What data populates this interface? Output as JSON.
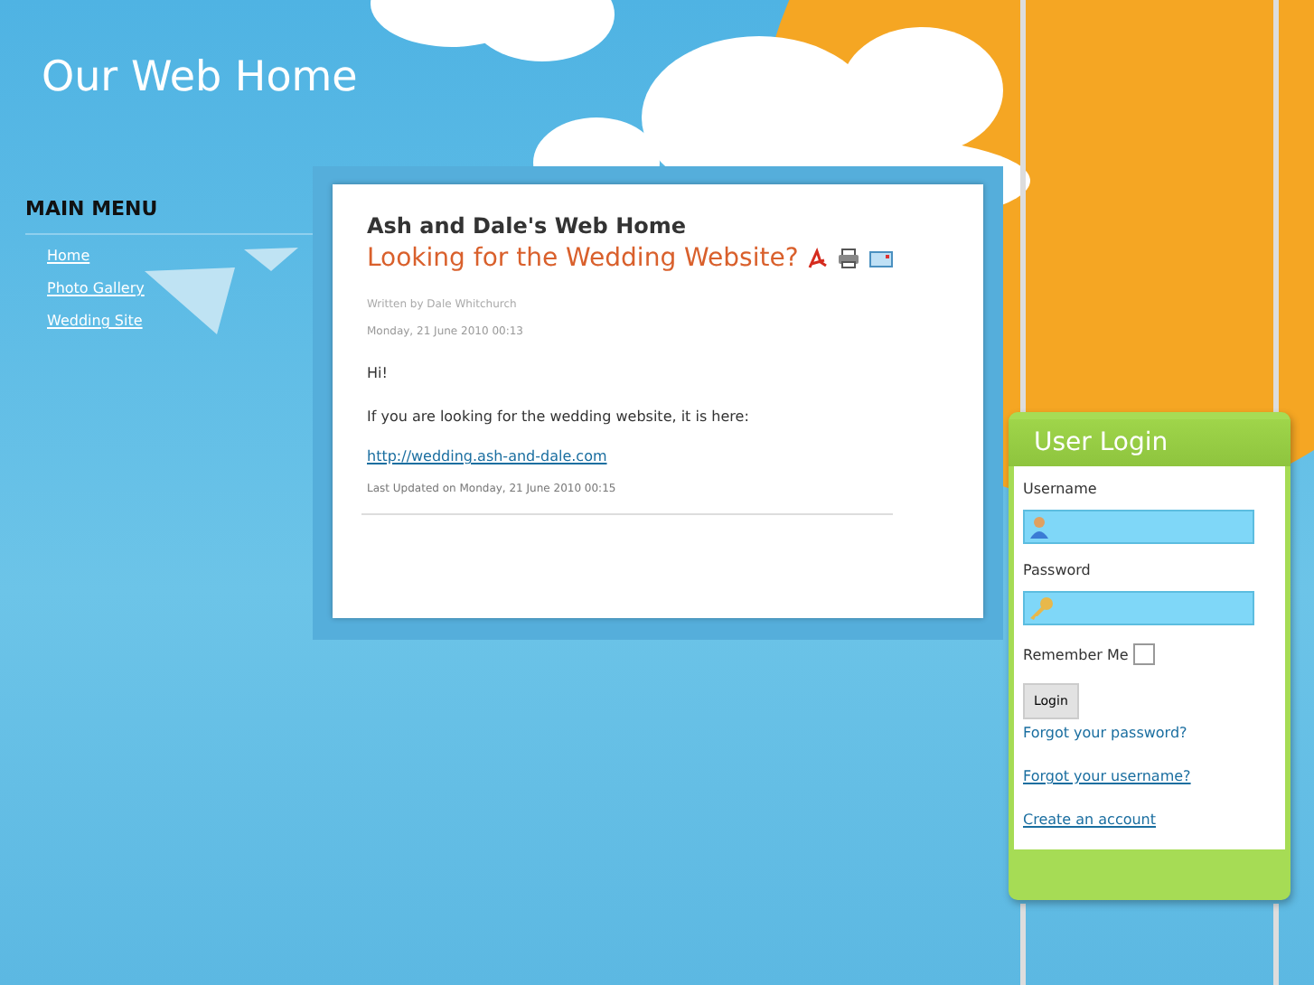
{
  "site_title": "Our Web Home",
  "main_menu": {
    "title": "MAIN MENU",
    "items": [
      {
        "label": "Home"
      },
      {
        "label": "Photo Gallery"
      },
      {
        "label": "Wedding Site"
      }
    ]
  },
  "article": {
    "site_heading": "Ash and Dale's Web Home",
    "title": "Looking for the Wedding Website?",
    "author": "Written by Dale Whitchurch",
    "date": "Monday, 21 June 2010 00:13",
    "paragraphs": [
      {
        "kind": "text",
        "text": "Hi!"
      },
      {
        "kind": "text",
        "text": "If you are looking for the wedding website, it is here:"
      },
      {
        "kind": "link",
        "text": "http://wedding.ash-and-dale.com"
      }
    ],
    "updated": "Last Updated on Monday, 21 June 2010 00:15"
  },
  "login": {
    "title": "User Login",
    "username_label": "Username",
    "password_label": "Password",
    "remember_label": "Remember Me",
    "remember_checked": false,
    "button": "Login",
    "links": [
      "Forgot your password?",
      "Forgot your username?",
      "Create an account"
    ]
  }
}
